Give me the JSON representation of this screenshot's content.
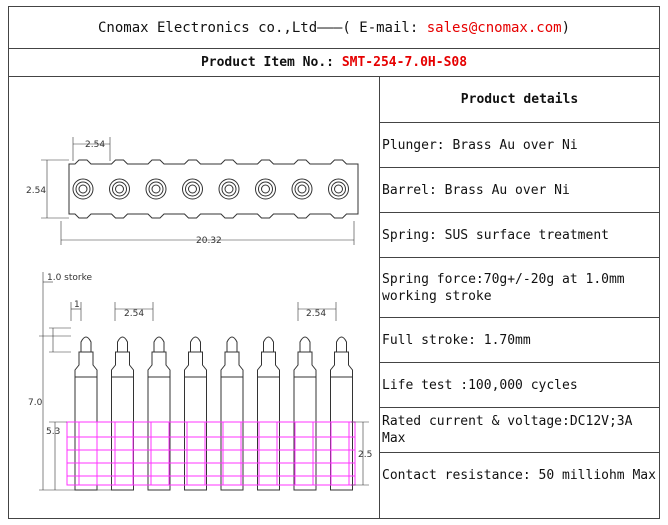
{
  "header": {
    "company": "Cnomax Electronics co.,Ltd———( E-mail: ",
    "email": "sales@cnomax.com",
    "close": ")"
  },
  "product_item": {
    "label": "Product Item No.: ",
    "value": "SMT-254-7.0H-S08"
  },
  "details": {
    "title": "Product details",
    "items": [
      "Plunger: Brass Au over Ni",
      "Barrel: Brass Au over Ni",
      "Spring: SUS surface treatment",
      "Spring force:70g+/-20g at 1.0mm working stroke",
      "Full stroke: 1.70mm",
      "Life test :100,000 cycles",
      "Rated current & voltage:DC12V;3A Max",
      "Contact resistance: 50 milliohm Max"
    ]
  },
  "drawing": {
    "top_view": {
      "pitch": "2.54",
      "height": "2.54",
      "length": "20.32"
    },
    "side_view": {
      "stroke": "1.0 storke",
      "stroke_value": "1",
      "pitch_left": "2.54",
      "pitch_right": "2.54",
      "height": "7.0",
      "body": "5.3",
      "base": "2.5"
    },
    "colors": {
      "line": "#333333",
      "highlight": "#ff33ff"
    }
  }
}
